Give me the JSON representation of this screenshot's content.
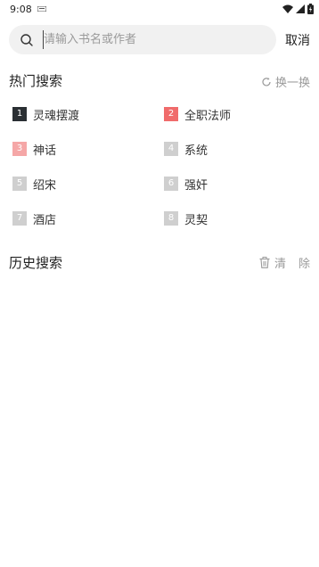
{
  "status_bar": {
    "time": "9:08"
  },
  "search": {
    "placeholder": "请输入书名或作者",
    "cancel_label": "取消"
  },
  "hot": {
    "title": "热门搜索",
    "refresh_label": "换一换",
    "items": [
      {
        "rank": "1",
        "label": "灵魂摆渡"
      },
      {
        "rank": "2",
        "label": "全职法师"
      },
      {
        "rank": "3",
        "label": "神话"
      },
      {
        "rank": "4",
        "label": "系统"
      },
      {
        "rank": "5",
        "label": "绍宋"
      },
      {
        "rank": "6",
        "label": "强奸"
      },
      {
        "rank": "7",
        "label": "酒店"
      },
      {
        "rank": "8",
        "label": "灵契"
      }
    ]
  },
  "history": {
    "title": "历史搜索",
    "clear_label": "清",
    "clear_label2": "除"
  },
  "colors": {
    "rank1": "#2a2f33",
    "rank2": "#f06b6b",
    "rank3": "#f5a7a7",
    "rank_other": "#cfcfcf"
  }
}
